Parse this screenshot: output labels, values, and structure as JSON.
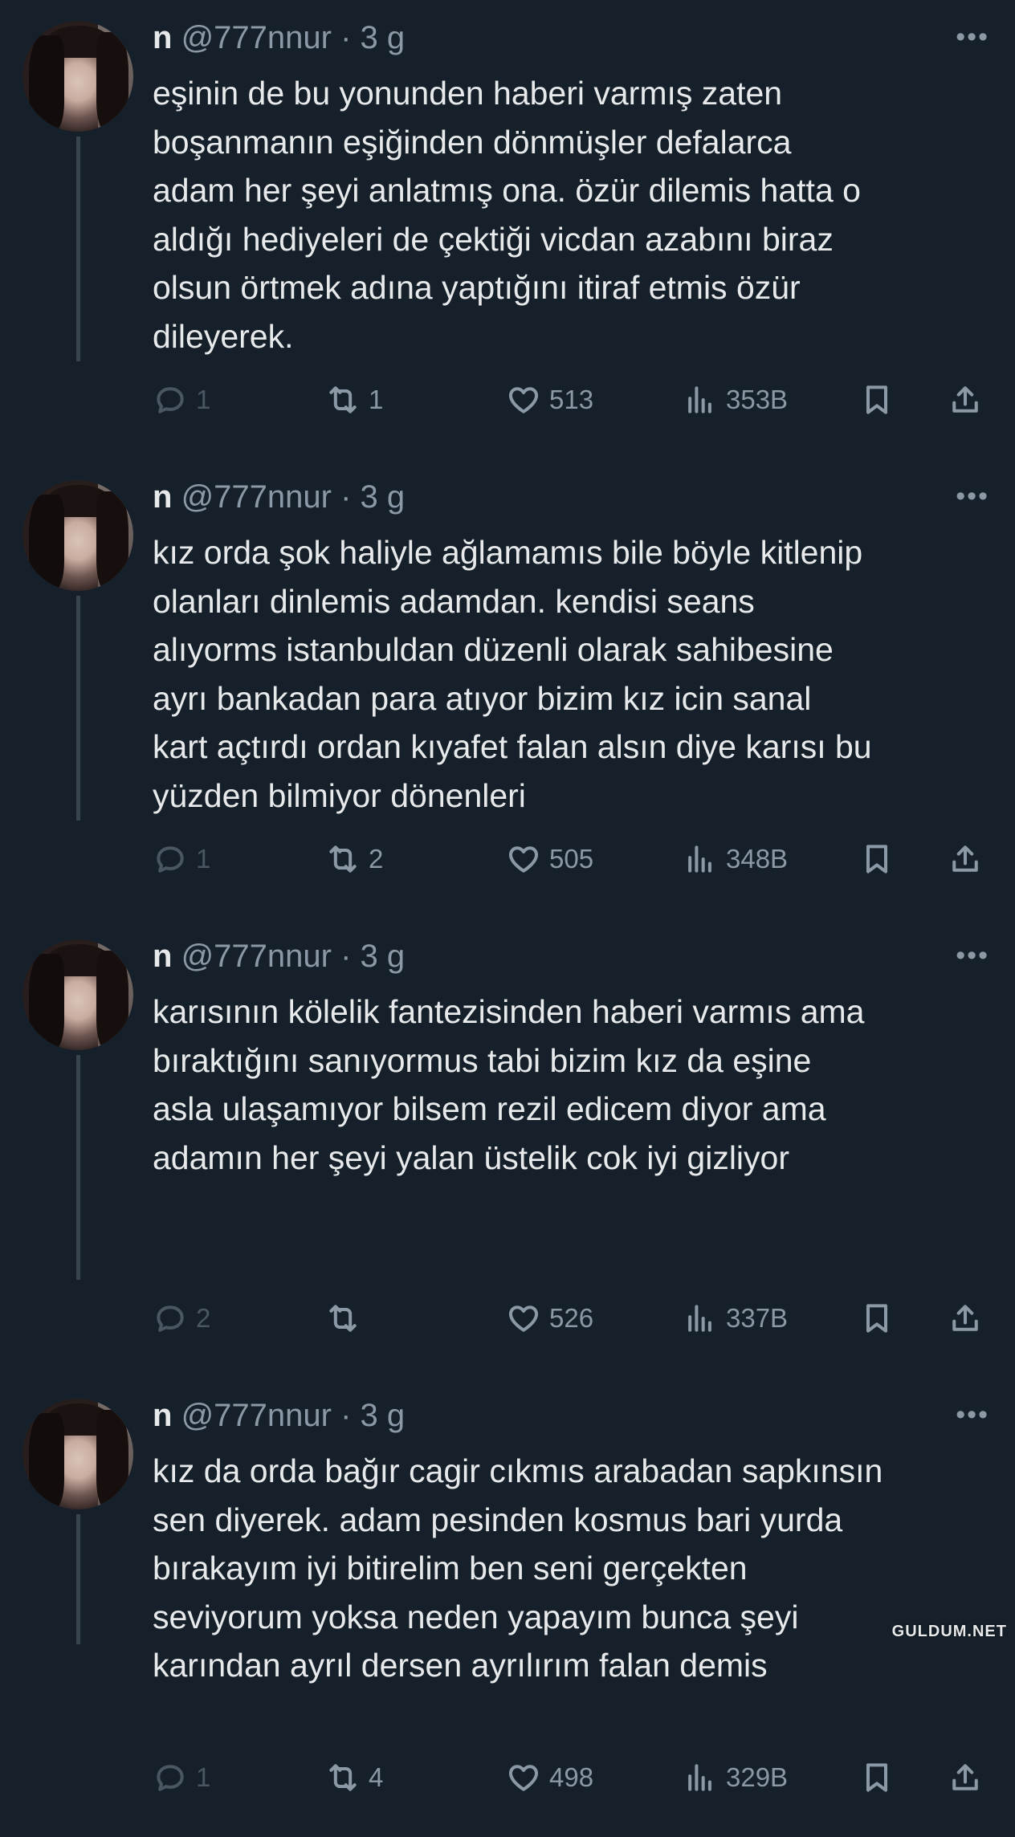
{
  "tweets": [
    {
      "name": "n",
      "handle": "@777nnur",
      "separator": "·",
      "time": "3 g",
      "text": "eşinin de bu yonunden haberi varmış zaten\nboşanmanın eşiğinden dönmüşler defalarca\nadam her şeyi anlatmış ona. özür dilemis hatta o\naldığı hediyeleri de çektiği vicdan azabını biraz\nolsun örtmek adına yaptığını itiraf etmis özür\ndileyerek.",
      "replies": "1",
      "retweets": "1",
      "likes": "513",
      "views": "353B"
    },
    {
      "name": "n",
      "handle": "@777nnur",
      "separator": "·",
      "time": "3 g",
      "text": "kız orda şok haliyle ağlamamıs bile böyle kitlenip\nolanları dinlemis adamdan. kendisi seans\nalıyorms istanbuldan düzenli olarak sahibesine\nayrı bankadan para atıyor bizim kız icin sanal\nkart açtırdı ordan kıyafet falan alsın diye karısı bu\nyüzden bilmiyor dönenleri",
      "replies": "1",
      "retweets": "2",
      "likes": "505",
      "views": "348B"
    },
    {
      "name": "n",
      "handle": "@777nnur",
      "separator": "·",
      "time": "3 g",
      "text": "karısının kölelik fantezisinden haberi varmıs ama\nbıraktığını sanıyormus tabi bizim kız da eşine\nasla ulaşamıyor bilsem rezil edicem diyor ama\nadamın her şeyi yalan üstelik cok iyi gizliyor",
      "replies": "2",
      "retweets": "",
      "likes": "526",
      "views": "337B"
    },
    {
      "name": "n",
      "handle": "@777nnur",
      "separator": "·",
      "time": "3 g",
      "text": "kız da orda bağır cagir cıkmıs arabadan sapkınsın\nsen diyerek. adam pesinden kosmus bari yurda\nbırakayım iyi bitirelim ben seni gerçekten\nseviyorum yoksa neden yapayım bunca şeyi\nkarından ayrıl dersen ayrılırım falan demis",
      "replies": "1",
      "retweets": "4",
      "likes": "498",
      "views": "329B"
    }
  ],
  "more_label": "•••",
  "watermark": "GULDUM.NET",
  "colors": {
    "background": "#15202b",
    "text": "#e7e9ea",
    "muted": "#8b98a5",
    "thread_line": "#38444d"
  },
  "icons": [
    "reply-icon",
    "retweet-icon",
    "like-icon",
    "views-icon",
    "bookmark-icon",
    "share-icon",
    "more-icon"
  ]
}
